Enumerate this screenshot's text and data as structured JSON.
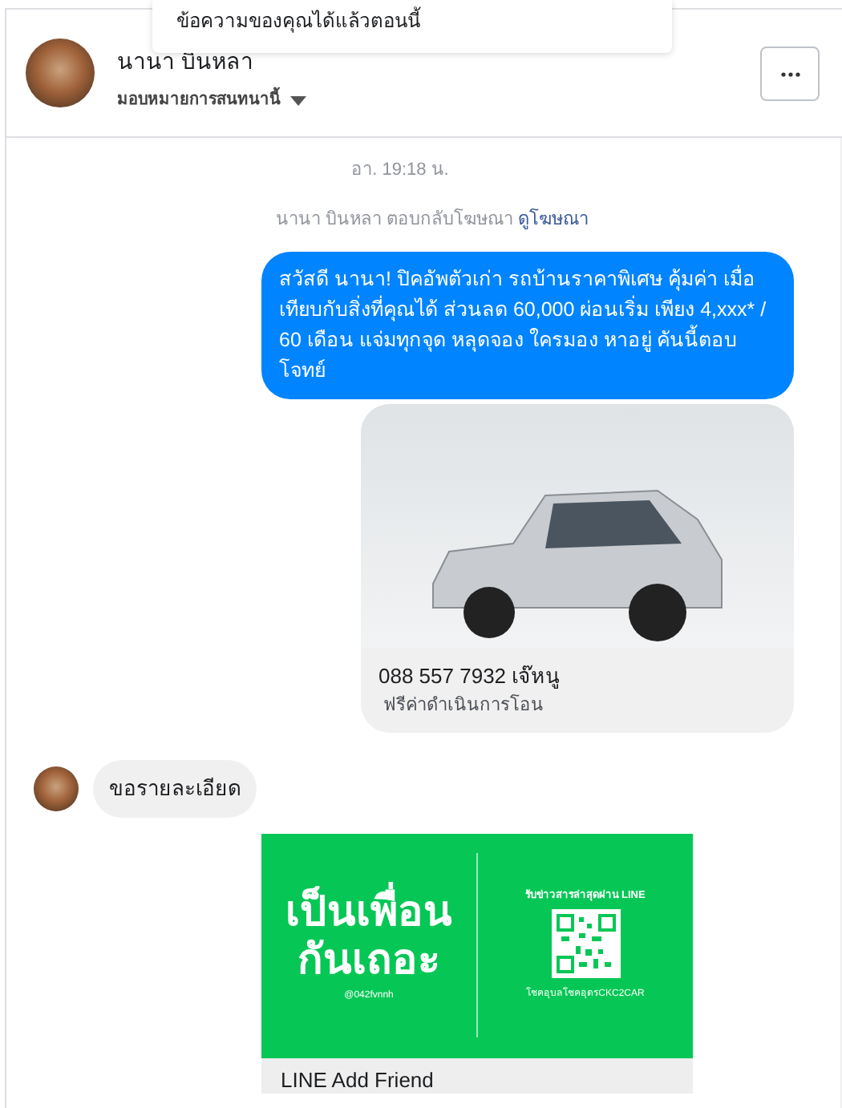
{
  "toast": {
    "text": "ข้อความของคุณได้แล้วตอนนี้"
  },
  "header": {
    "name": "นานา บินหลา",
    "assign_label": "มอบหมายการสนทนานี้"
  },
  "conversation": {
    "timestamp": "อา. 19:18 น.",
    "reply_note": "นานา บินหลา ตอบกลับโฆษณา",
    "reply_link": "ดูโฆษณา",
    "messages": [
      {
        "kind": "outgoing_text",
        "text": "สวัสดี นานา! ปิคอัพตัวเก่า รถบ้านราคาพิเศษ คุ้มค่า เมื่อเทียบกับสิ่งที่คุณได้  ส่วนลด 60,000 ผ่อนเริ่ม เพียง 4,xxx* / 60 เดือน แจ่มทุกจุด หลุดจอง ใครมอง หาอยู่ คันนี้ตอบโจทย์"
      },
      {
        "kind": "outgoing_card",
        "title": "088 557 7932 เจ๊หนู",
        "subtitle": "ฟรีค่าดำเนินการโอน"
      },
      {
        "kind": "incoming_text",
        "text": "ขอรายละเอียด"
      },
      {
        "kind": "outgoing_banner",
        "headline": "เป็นเพื่อน กันเถอะ",
        "handle": "@042fvnnh",
        "qr_title": "รับข่าวสารล่าสุดผ่าน LINE",
        "qr_caption": "โชคอุบลโชคอุดรCKC2CAR",
        "title": "LINE Add Friend"
      }
    ]
  }
}
